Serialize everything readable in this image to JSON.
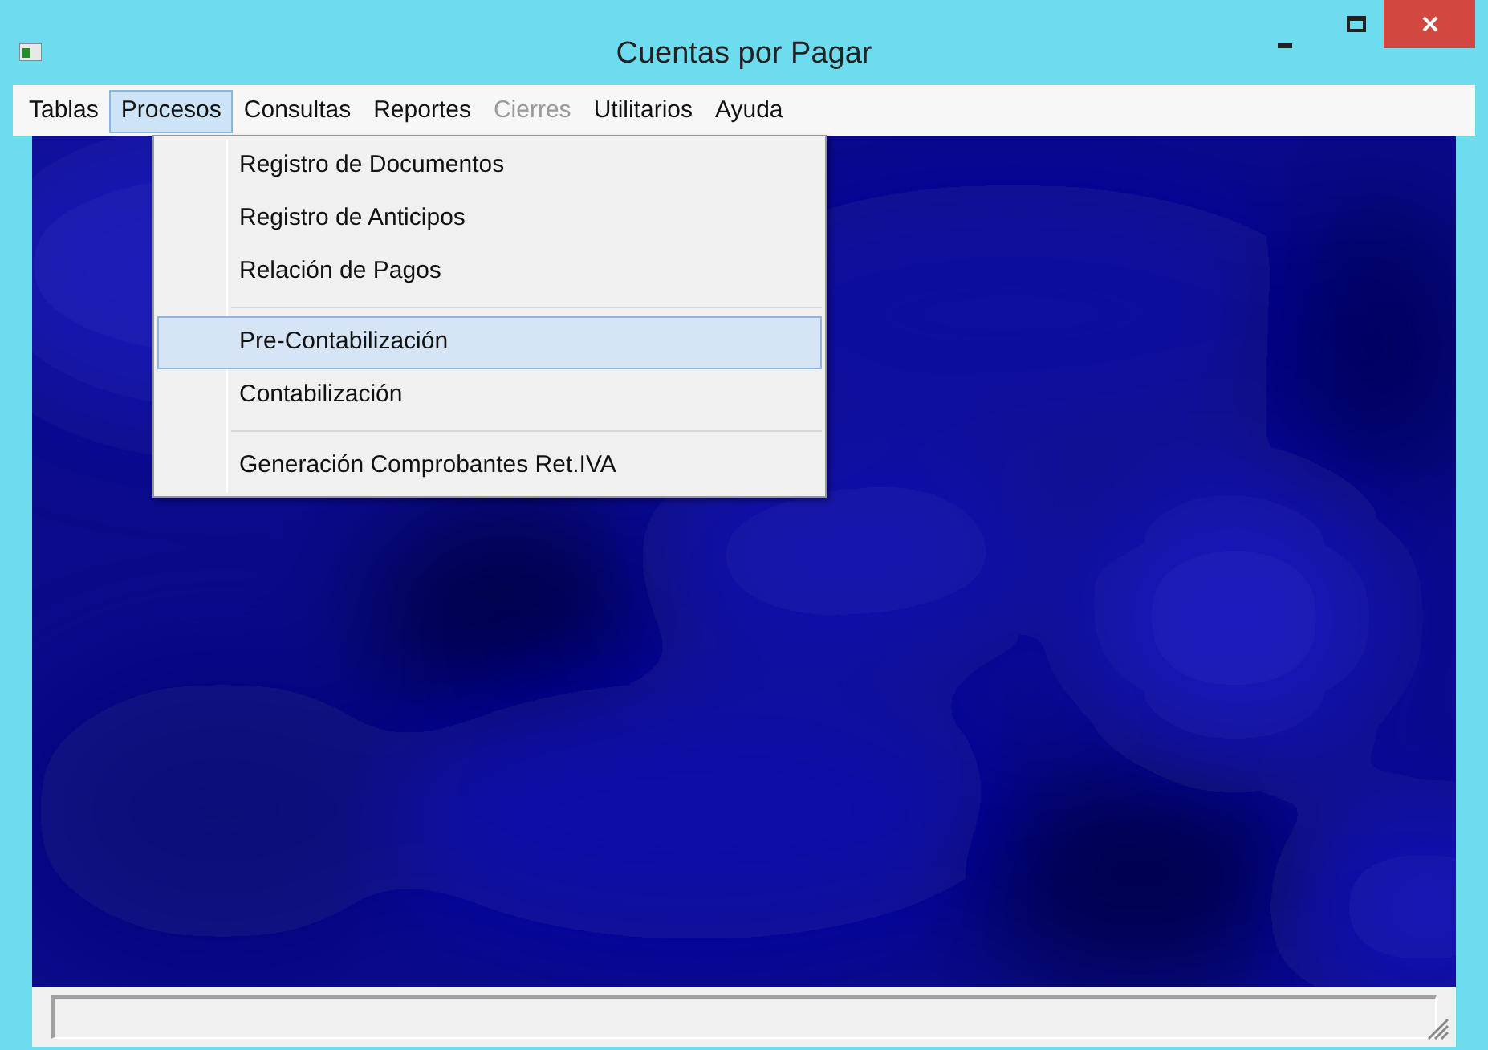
{
  "window": {
    "title": "Cuentas por Pagar"
  },
  "menu_bar": [
    {
      "label": "Tablas",
      "selected": false,
      "disabled": false
    },
    {
      "label": "Procesos",
      "selected": true,
      "disabled": false
    },
    {
      "label": "Consultas",
      "selected": false,
      "disabled": false
    },
    {
      "label": "Reportes",
      "selected": false,
      "disabled": false
    },
    {
      "label": "Cierres",
      "selected": false,
      "disabled": true
    },
    {
      "label": "Utilitarios",
      "selected": false,
      "disabled": false
    },
    {
      "label": "Ayuda",
      "selected": false,
      "disabled": false
    }
  ],
  "dropdown": [
    {
      "kind": "item",
      "label": "Registro de Documentos",
      "selected": false
    },
    {
      "kind": "item",
      "label": "Registro de Anticipos",
      "selected": false
    },
    {
      "kind": "item",
      "label": "Relación de Pagos",
      "selected": false
    },
    {
      "kind": "separator"
    },
    {
      "kind": "item",
      "label": "Pre-Contabilización",
      "selected": true
    },
    {
      "kind": "item",
      "label": "Contabilización",
      "selected": false
    },
    {
      "kind": "separator"
    },
    {
      "kind": "item",
      "label": "Generación Comprobantes Ret.IVA",
      "selected": false
    }
  ]
}
